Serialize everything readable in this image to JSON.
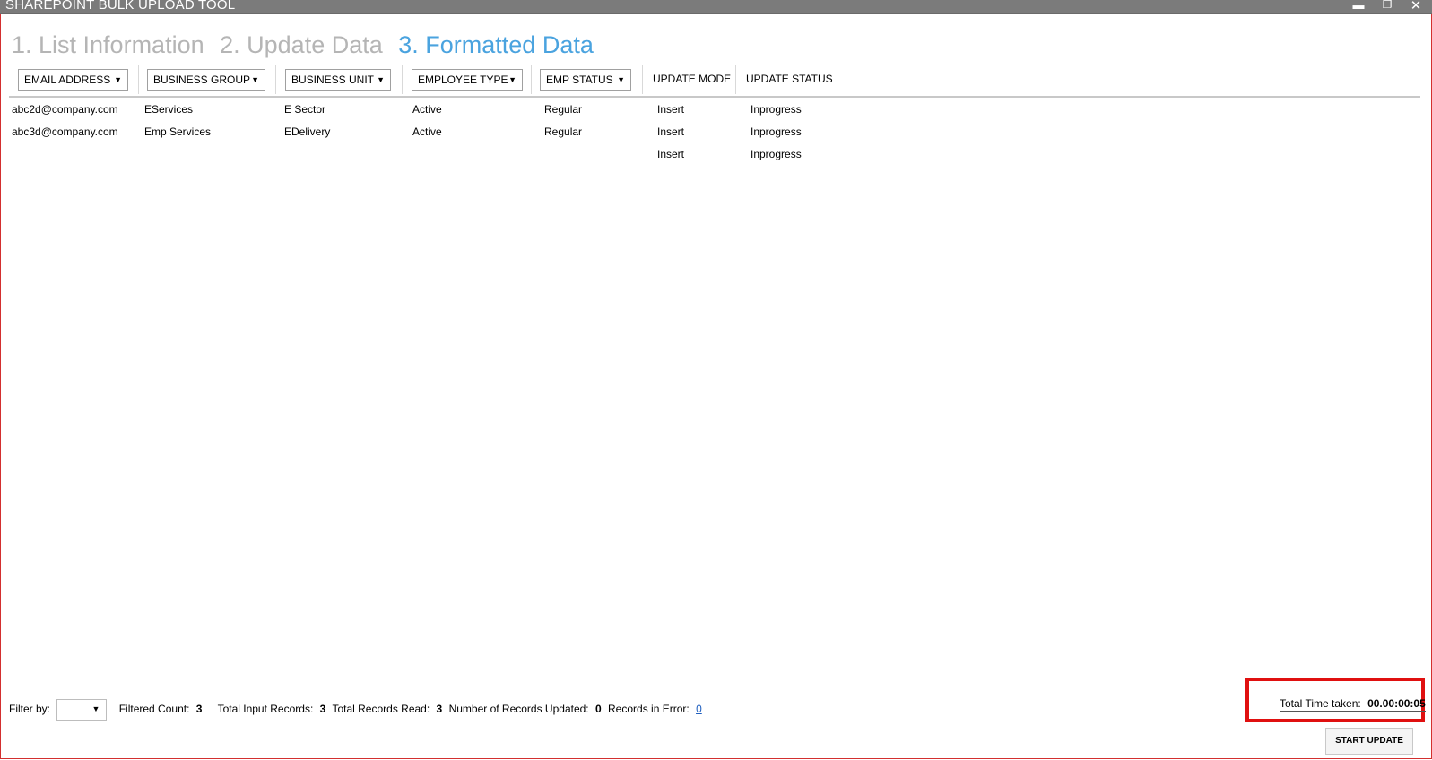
{
  "window": {
    "title": "SHAREPOINT BULK UPLOAD TOOL",
    "minimize_icon": "minimize-icon",
    "restore_icon": "restore-icon",
    "close_icon": "close-icon"
  },
  "steps": [
    {
      "label": "1. List Information",
      "state": "inactive"
    },
    {
      "label": "2. Update Data",
      "state": "inactive"
    },
    {
      "label": "3. Formatted Data",
      "state": "active"
    }
  ],
  "columns": [
    {
      "label": "EMAIL ADDRESS",
      "dropdown": true
    },
    {
      "label": "BUSINESS GROUP",
      "dropdown": true
    },
    {
      "label": "BUSINESS UNIT",
      "dropdown": true
    },
    {
      "label": "EMPLOYEE TYPE",
      "dropdown": true
    },
    {
      "label": "EMP STATUS",
      "dropdown": true
    },
    {
      "label": "UPDATE MODE",
      "dropdown": false
    },
    {
      "label": "UPDATE STATUS",
      "dropdown": false
    }
  ],
  "rows": [
    [
      "abc2d@company.com",
      "EServices",
      "E Sector",
      "Active",
      "Regular",
      "Insert",
      "Inprogress"
    ],
    [
      "abc3d@company.com",
      "Emp Services",
      "EDelivery",
      "Active",
      "Regular",
      "Insert",
      "Inprogress"
    ],
    [
      "",
      "",
      "",
      "",
      "",
      "Insert",
      "Inprogress"
    ]
  ],
  "footer": {
    "filter_label": "Filter by:",
    "filter_value": "",
    "filtered_count_label": "Filtered Count:",
    "filtered_count": "3",
    "total_input_label": "Total Input Records:",
    "total_input": "3",
    "total_read_label": "Total Records Read:",
    "total_read": "3",
    "updated_label": "Number of Records Updated:",
    "updated": "0",
    "error_label": "Records in Error:",
    "error": "0",
    "time_label": "Total Time taken:",
    "time_value": "00.00:00:05",
    "start_button": "START UPDATE"
  },
  "colors": {
    "active_step": "#4aa3df",
    "inactive_step": "#b5b5b5",
    "highlight_box": "#e01010",
    "titlebar": "#7b7b7b"
  }
}
